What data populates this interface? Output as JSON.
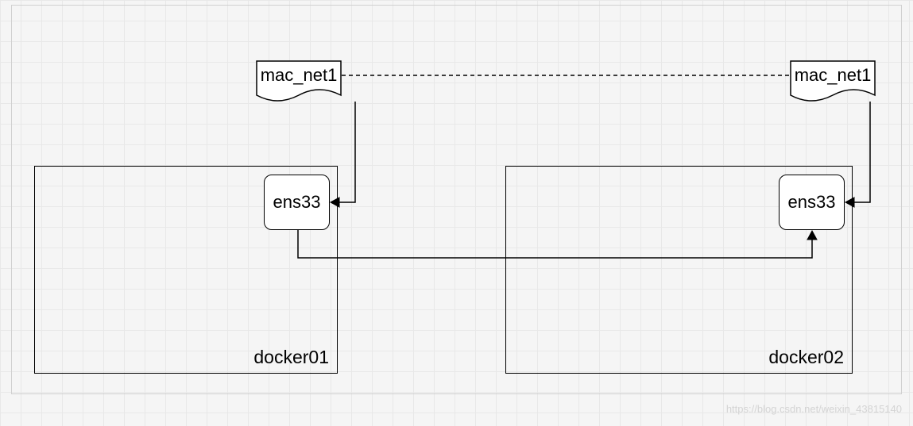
{
  "nodes": {
    "macnet_left": {
      "label": "mac_net1"
    },
    "macnet_right": {
      "label": "mac_net1"
    },
    "ens_left": {
      "label": "ens33"
    },
    "ens_right": {
      "label": "ens33"
    }
  },
  "hosts": {
    "left": {
      "label": "docker01"
    },
    "right": {
      "label": "docker02"
    }
  },
  "watermark": "https://blog.csdn.net/weixin_43815140"
}
